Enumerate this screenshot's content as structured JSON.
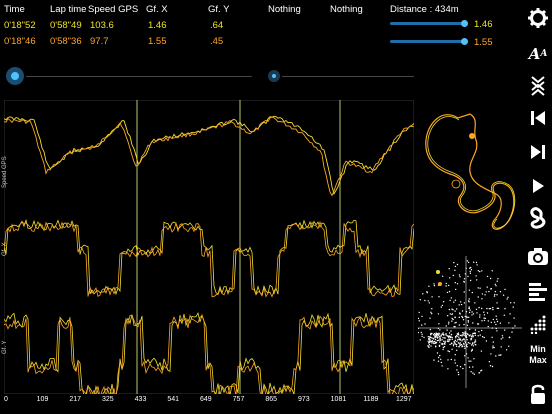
{
  "header": {
    "columns": [
      "Time",
      "Lap time",
      "Speed GPS",
      "Gf. X",
      "Gf. Y",
      "Nothing",
      "Nothing"
    ],
    "rows": [
      {
        "color": "#f2e22a",
        "values": [
          "0'18\"52",
          "0'58\"49",
          "103.6",
          "1.46",
          ".64",
          "",
          ""
        ]
      },
      {
        "color": "#ffa726",
        "values": [
          "0'18\"46",
          "0'58\"36",
          "97.7",
          "1.55",
          ".45",
          "",
          ""
        ]
      }
    ],
    "distance_label": "Distance : 434m",
    "bar1_value": "1.46",
    "bar2_value": "1.55"
  },
  "axis": {
    "y_labels": [
      "Speed GPS",
      "Gf. X",
      "Gf. Y"
    ],
    "x_ticks": [
      "0",
      "109",
      "217",
      "325",
      "433",
      "541",
      "649",
      "757",
      "865",
      "973",
      "1081",
      "1189",
      "1297"
    ]
  },
  "toolbar": {
    "items": [
      "settings",
      "font-size",
      "expand",
      "first",
      "last",
      "play",
      "track",
      "camera",
      "lines",
      "scatter",
      "min-max",
      "lock"
    ],
    "min_label": "Min",
    "max_label": "Max"
  },
  "colors": {
    "yellow": "#f2e22a",
    "orange": "#ffa726"
  }
}
